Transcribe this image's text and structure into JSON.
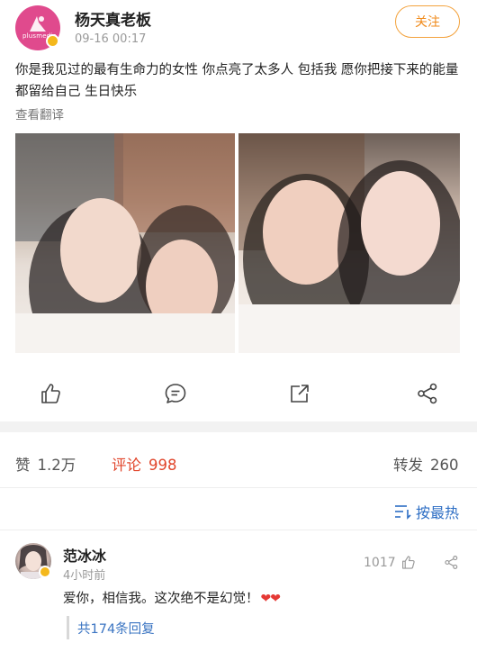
{
  "post": {
    "username": "杨天真老板",
    "time": "09-16 00:17",
    "follow_label": "关注",
    "text": "你是我见过的最有生命力的女性 你点亮了太多人 包括我 愿你把接下来的能量都留给自己 生日快乐",
    "translate_label": "查看翻译",
    "avatar_brand": "plusmedia"
  },
  "stats": {
    "likes_label": "赞",
    "likes_count": "1.2万",
    "comments_label": "评论",
    "comments_count": "998",
    "reposts_label": "转发",
    "reposts_count": "260"
  },
  "sort": {
    "label": "按最热"
  },
  "comment": {
    "name": "范冰冰",
    "time": "4小时前",
    "likes": "1017",
    "text": "爱你，相信我。这次绝不是幻觉！",
    "emoji": "❤❤",
    "replies_label": "共174条回复"
  },
  "icons": [
    "thumb-up-icon",
    "comment-icon",
    "repost-icon",
    "share-icon",
    "verified-badge-icon",
    "sort-icon"
  ],
  "colors": {
    "accent": "#f08a1a",
    "comment_red": "#e1462c",
    "link_blue": "#2d6ec4"
  }
}
